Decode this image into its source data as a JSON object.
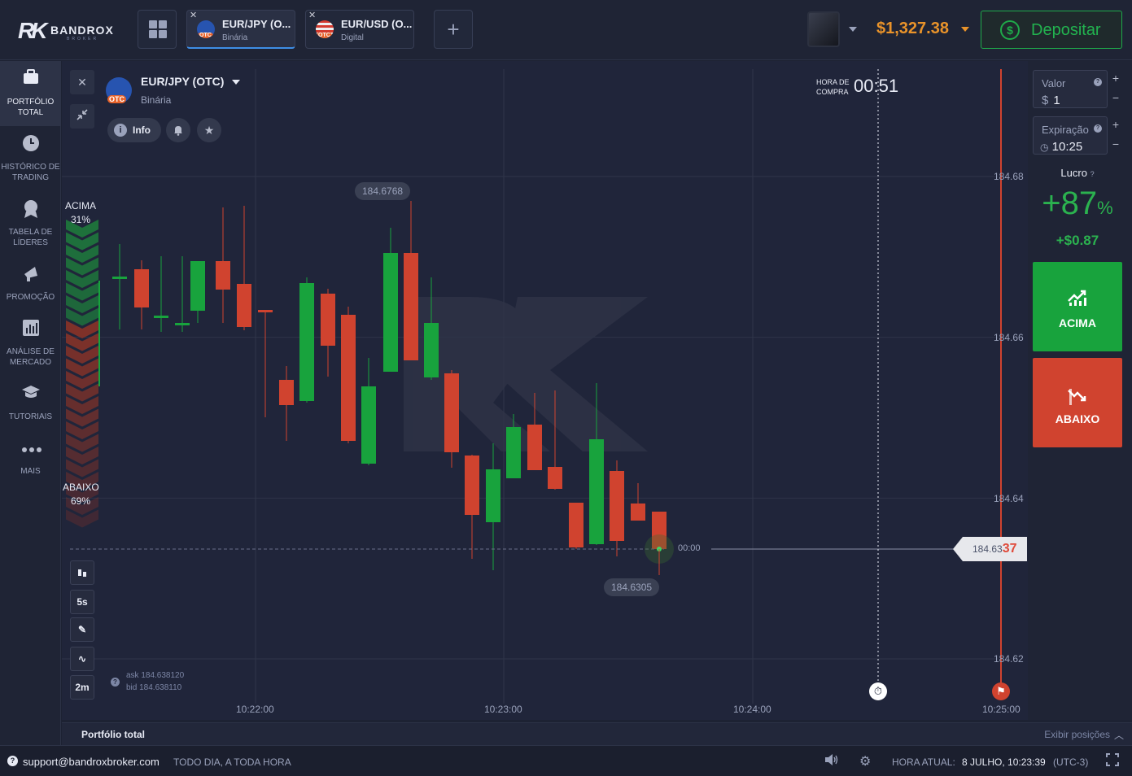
{
  "brand": {
    "logo_mark": "RK",
    "name": "BANDROX",
    "sub": "BROKER"
  },
  "tabs": [
    {
      "name": "EUR/JPY (O...",
      "type": "Binária",
      "badge": "OTC",
      "active": true
    },
    {
      "name": "EUR/USD (O...",
      "type": "Digital",
      "badge": "OTC",
      "active": false
    }
  ],
  "header": {
    "balance": "$1,327.38",
    "deposit_label": "Depositar",
    "deposit_icon": "$"
  },
  "sidebar": {
    "items": [
      {
        "label": "PORTFÓLIO TOTAL",
        "icon": "briefcase-icon",
        "active": true
      },
      {
        "label": "HISTÓRICO DE TRADING",
        "icon": "clock-icon"
      },
      {
        "label": "TABELA DE LÍDERES",
        "icon": "medal-icon"
      },
      {
        "label": "PROMOÇÃO",
        "icon": "megaphone-icon"
      },
      {
        "label": "ANÁLISE DE MERCADO",
        "icon": "bar-chart-icon"
      },
      {
        "label": "TUTORIAIS",
        "icon": "graduation-cap-icon"
      },
      {
        "label": "MAIS",
        "icon": "more-dots-icon"
      }
    ]
  },
  "chart_header": {
    "pair": "EUR/JPY (OTC)",
    "type": "Binária",
    "badge": "OTC",
    "info_label": "Info"
  },
  "sentiment": {
    "up_label": "ACIMA",
    "up_pct": "31%",
    "down_label": "ABAIXO",
    "down_pct": "69%"
  },
  "buy_time": {
    "label_1": "HORA DE",
    "label_2": "COMPRA",
    "value": "00:51"
  },
  "tools": {
    "timeframe": "5s",
    "zoom": "2m"
  },
  "chart_data": {
    "type": "candlestick",
    "ylim": [
      184.615,
      184.69
    ],
    "yticks": [
      "184.68",
      "184.66",
      "184.64",
      "184.62"
    ],
    "xticks": [
      "10:22:00",
      "10:23:00",
      "10:24:00",
      "10:25:00"
    ],
    "candles": [
      {
        "o": 184.6474,
        "h": 184.6649,
        "l": 184.6528,
        "c": 184.6468
      },
      {
        "o": 184.6474,
        "h": 184.6705,
        "l": 184.6575,
        "c": 184.6474
      },
      {
        "o": 184.6455,
        "h": 184.6688,
        "l": 184.6495,
        "c": 184.6455
      },
      {
        "o": 184.6598,
        "h": 184.6534,
        "l": 184.6515,
        "c": 184.6598
      },
      {
        "o": 184.6455,
        "h": 184.6592,
        "l": 184.6501,
        "c": 184.6455
      },
      {
        "o": 184.6486,
        "h": 184.6576,
        "l": 184.6473,
        "c": 184.6486
      },
      {
        "o": 184.6456,
        "h": 184.6608,
        "l": 184.6515,
        "c": 184.6456
      },
      {
        "o": 184.6456,
        "h": 184.6622,
        "l": 184.6484,
        "c": 184.6456
      },
      {
        "o": 184.6463,
        "h": 184.665,
        "l": 184.6616,
        "c": 184.6463
      },
      {
        "o": 184.6486,
        "h": 184.6587,
        "l": 184.6426,
        "c": 184.6486
      },
      {
        "o": 184.648,
        "h": 184.6599,
        "l": 184.6549,
        "c": 184.648
      },
      {
        "o": 184.646,
        "h": 184.6617,
        "l": 184.6617,
        "c": 184.646
      },
      {
        "o": 184.6402,
        "h": 184.656,
        "l": 184.6465,
        "c": 184.6402
      },
      {
        "o": 184.6454,
        "h": 184.6663,
        "l": 184.6506,
        "c": 184.6454
      },
      {
        "o": 184.6495,
        "h": 184.6542,
        "l": 184.6514,
        "c": 184.6495
      },
      {
        "o": 184.6602,
        "h": 184.6526,
        "l": 184.6556,
        "c": 184.6602
      },
      {
        "o": 184.658,
        "h": 184.6627,
        "l": 184.651,
        "c": 184.658
      },
      {
        "o": 184.6435,
        "h": 184.6585,
        "l": 184.6448,
        "c": 184.6435
      },
      {
        "o": 184.6466,
        "h": 184.657,
        "l": 184.649,
        "c": 184.6466
      },
      {
        "o": 184.6391,
        "h": 184.6569,
        "l": 184.6465,
        "c": 184.6391
      },
      {
        "o": 184.653,
        "h": 184.6438,
        "l": 184.6532,
        "c": 184.653
      },
      {
        "o": 184.6382,
        "h": 184.6491,
        "l": 184.6449,
        "c": 184.6382
      },
      {
        "o": 184.6374,
        "h": 184.6508,
        "l": 184.648,
        "c": 184.6374
      },
      {
        "o": 184.6466,
        "h": 184.6441,
        "l": 184.6469,
        "c": 184.6466
      },
      {
        "o": 184.6399,
        "h": 184.6454,
        "l": 184.6433,
        "c": 184.6399
      },
      {
        "o": 184.64,
        "h": 184.6423,
        "l": 184.6403,
        "c": 184.64
      }
    ],
    "current_price": "184.6337",
    "current_price_main": "184.63",
    "current_price_end": "37",
    "high_label": "184.6768",
    "low_label": "184.6305",
    "expiry_countdown": "00:00"
  },
  "quote": {
    "ask": "ask 184.638120",
    "bid": "bid 184.638110"
  },
  "trade": {
    "value_label": "Valor",
    "value_currency": "$",
    "value": "1",
    "expiry_label": "Expiração",
    "expiry": "10:25",
    "profit_label": "Lucro",
    "profit_pct": "+87",
    "profit_pct_sign": "%",
    "profit_amount": "+$0.87",
    "up_label": "ACIMA",
    "down_label": "ABAIXO"
  },
  "portfolio": {
    "title": "Portfólio total",
    "show_positions": "Exibir posições"
  },
  "status": {
    "email": "support@bandroxbroker.com",
    "slogan": "TODO DIA, A TODA HORA",
    "clock_label": "HORA ATUAL:",
    "clock_value": "8 JULHO, 10:23:39",
    "timezone": "(UTC-3)"
  },
  "colors": {
    "green": "#18a33d",
    "red": "#d0432f",
    "accent": "#3e8ee6",
    "balance": "#e9932a"
  }
}
